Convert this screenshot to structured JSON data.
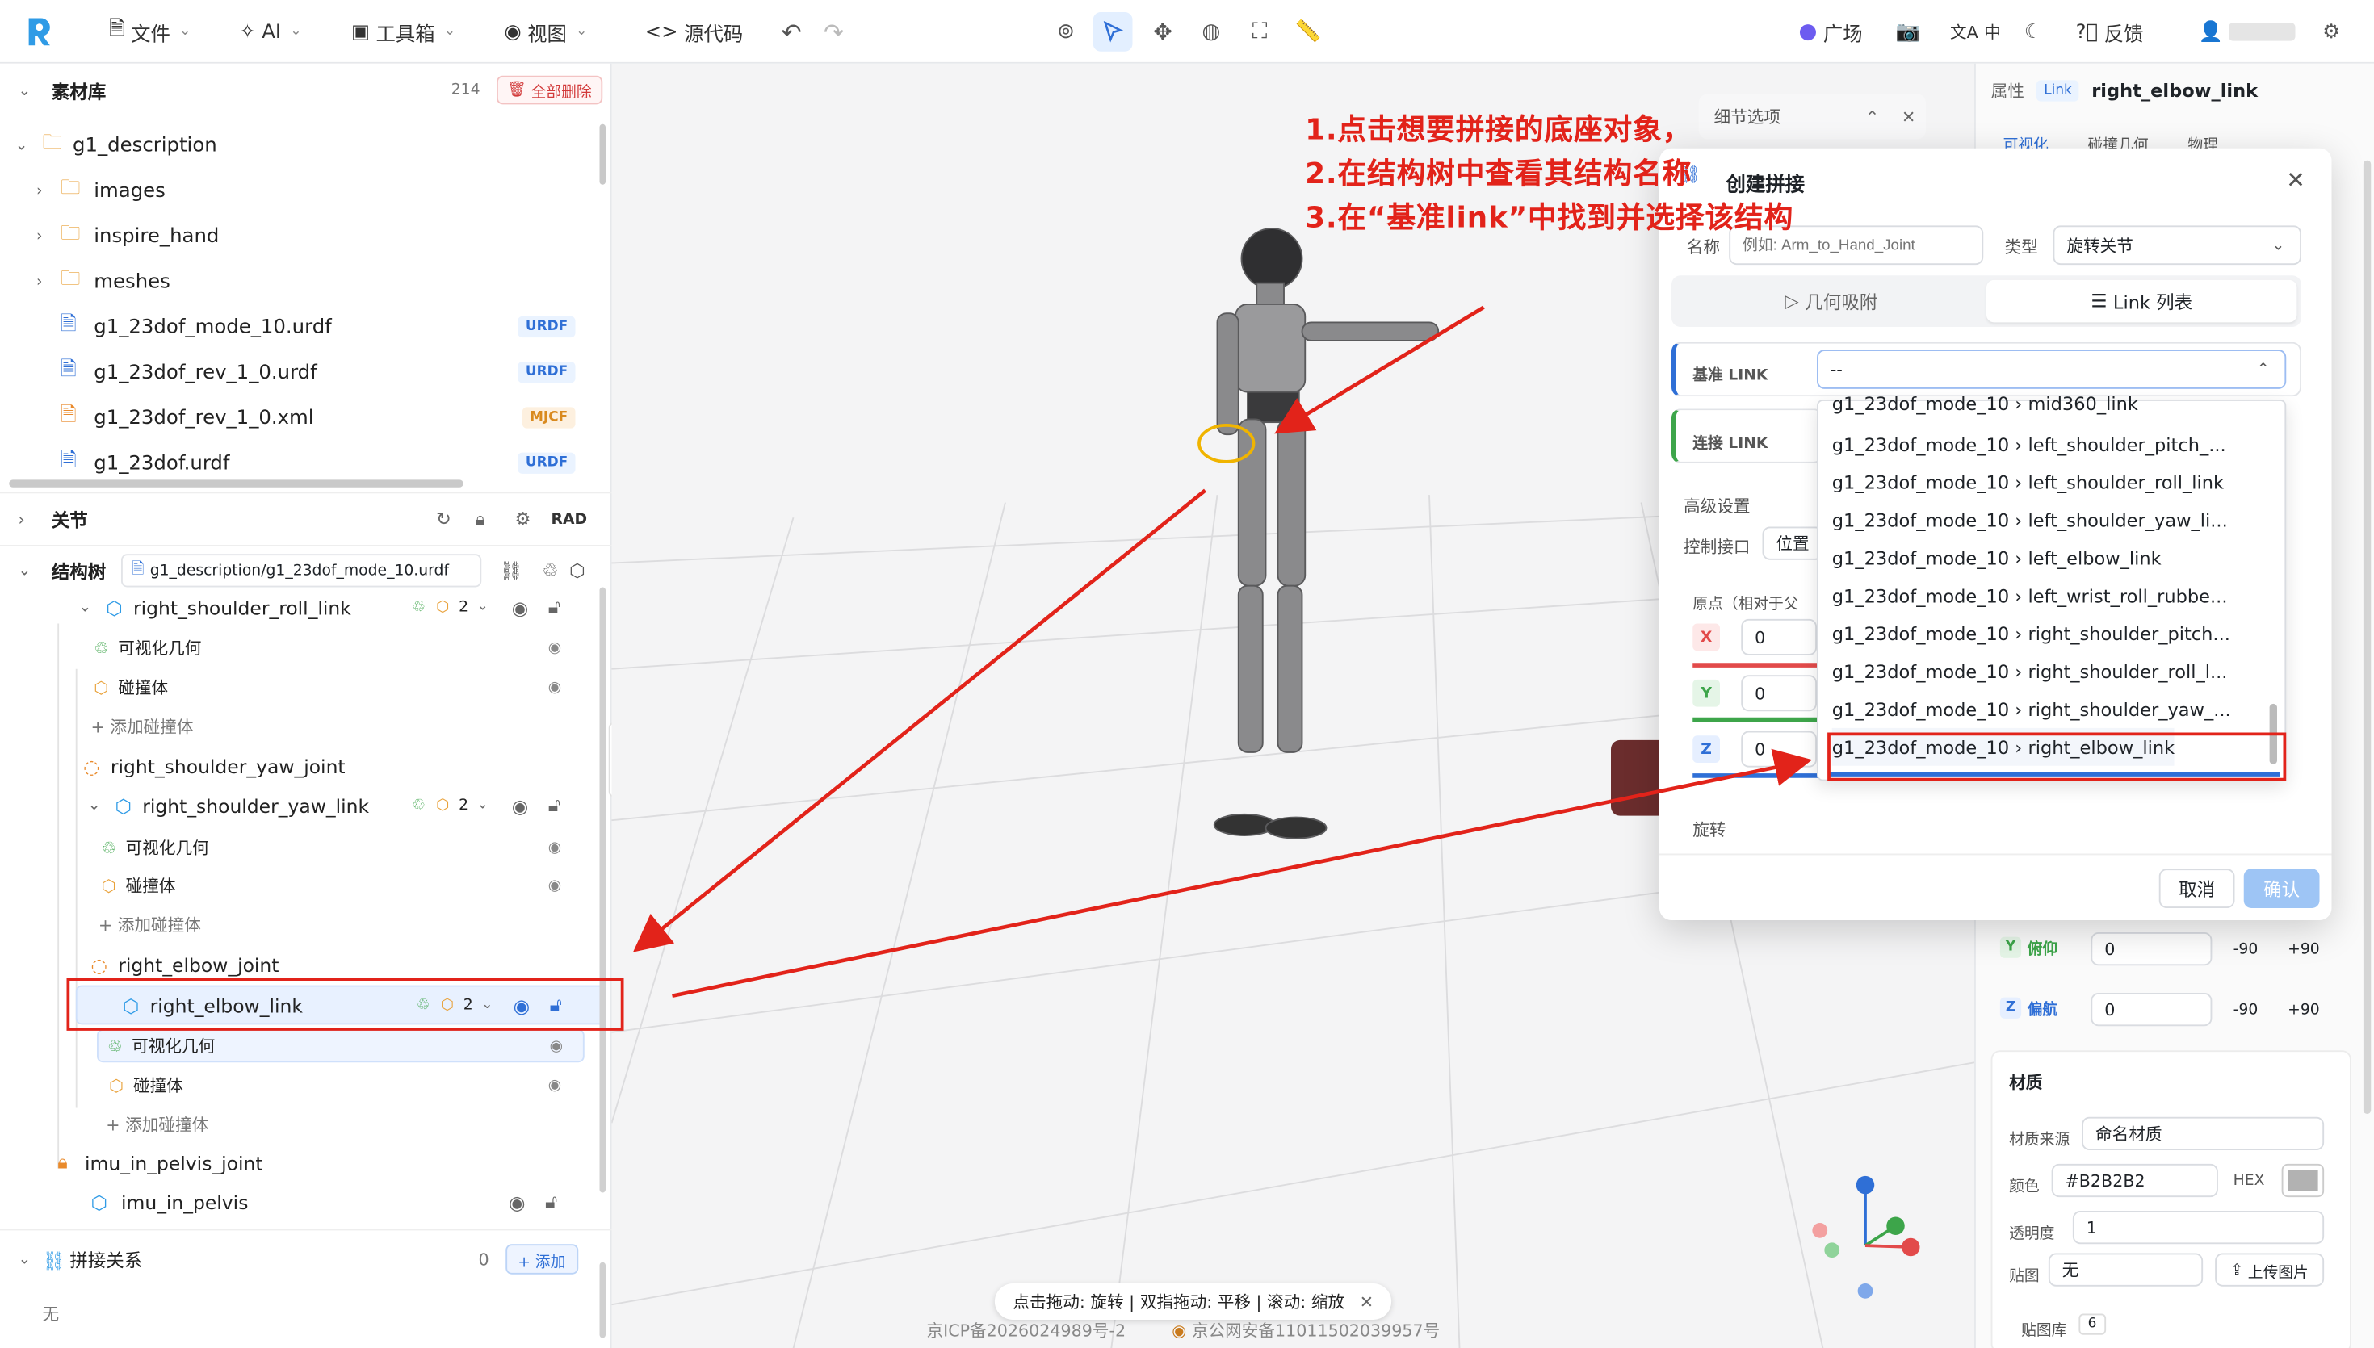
{
  "topbar": {
    "menus": [
      "文件",
      "AI",
      "工具箱",
      "视图",
      "源代码"
    ],
    "right_items": {
      "plaza": "广场",
      "lang": "中",
      "feedback": "反馈"
    }
  },
  "assets": {
    "title": "素材库",
    "count": "214",
    "delete_all": "全部删除",
    "root": "g1_description",
    "folders": [
      "images",
      "inspire_hand",
      "meshes"
    ],
    "files": [
      {
        "name": "g1_23dof_mode_10.urdf",
        "tag": "URDF"
      },
      {
        "name": "g1_23dof_rev_1_0.urdf",
        "tag": "URDF"
      },
      {
        "name": "g1_23dof_rev_1_0.xml",
        "tag": "MJCF"
      },
      {
        "name": "g1_23dof.urdf",
        "tag": "URDF"
      }
    ]
  },
  "joints_section": {
    "title": "关节",
    "unit": "RAD"
  },
  "structure": {
    "title": "结构树",
    "file": "g1_description/g1_23dof_mode_10.urdf",
    "rows": {
      "r1": "right_shoulder_roll_link",
      "vis": "可视化几何",
      "col": "碰撞体",
      "add_col": "+ 添加碰撞体",
      "r2": "right_shoulder_yaw_joint",
      "r3": "right_shoulder_yaw_link",
      "r4": "right_elbow_joint",
      "r5": "right_elbow_link",
      "r6": "imu_in_pelvis_joint",
      "r7": "imu_in_pelvis"
    },
    "count": "2"
  },
  "splice": {
    "title": "拼接关系",
    "count": "0",
    "add": "+ 添加",
    "empty": "无"
  },
  "viewport": {
    "hint": "点击拖动: 旋转 | 双指拖动: 平移 | 滚动: 缩放",
    "icp1": "京ICP备2026024989号-2",
    "icp2": "京公网安备11011502039957号",
    "details_title": "细节选项"
  },
  "annotations": [
    "1.点击想要拼接的底座对象，",
    "2.在结构树中查看其结构名称",
    "3.在“基准link”中找到并选择该结构"
  ],
  "dialog": {
    "title": "创建拼接",
    "name_label": "名称",
    "name_placeholder": "例如: Arm_to_Hand_Joint",
    "type_label": "类型",
    "type_value": "旋转关节",
    "tab_geo": "几何吸附",
    "tab_list": "Link 列表",
    "base_link": "基准 LINK",
    "base_value": "--",
    "conn_link": "连接 LINK",
    "advanced": "高级设置",
    "control": "控制接口",
    "control_value": "位置",
    "origin": "原点（相对于父",
    "axes": [
      "X",
      "Y",
      "Z"
    ],
    "zero": "0",
    "rotation": "旋转",
    "cancel": "取消",
    "confirm": "确认",
    "options": [
      "g1_23dof_mode_10 › mid360_link",
      "g1_23dof_mode_10 › left_shoulder_pitch_...",
      "g1_23dof_mode_10 › left_shoulder_roll_link",
      "g1_23dof_mode_10 › left_shoulder_yaw_li...",
      "g1_23dof_mode_10 › left_elbow_link",
      "g1_23dof_mode_10 › left_wrist_roll_rubbe...",
      "g1_23dof_mode_10 › right_shoulder_pitch...",
      "g1_23dof_mode_10 › right_shoulder_roll_l...",
      "g1_23dof_mode_10 › right_shoulder_yaw_...",
      "g1_23dof_mode_10 › right_elbow_link"
    ]
  },
  "props": {
    "title": "属性",
    "tag": "Link",
    "name": "right_elbow_link",
    "tabs": [
      "可视化",
      "碰撞几何",
      "物理"
    ],
    "pitch": {
      "axis": "Y",
      "label": "俯仰",
      "value": "0",
      "min": "-90",
      "max": "+90"
    },
    "yaw": {
      "axis": "Z",
      "label": "偏航",
      "value": "0",
      "min": "-90",
      "max": "+90"
    },
    "material": "材质",
    "mat_source_label": "材质来源",
    "mat_source": "命名材质",
    "color_label": "颜色",
    "color_value": "#B2B2B2",
    "hex": "HEX",
    "opacity_label": "透明度",
    "opacity": "1",
    "texture_label": "贴图",
    "texture": "无",
    "upload": "上传图片",
    "texlib": "贴图库",
    "texlib_count": "6"
  },
  "colors": {
    "accent": "#2f6fd6",
    "annot": "#e2231a",
    "x": "#e24a4a",
    "y": "#3da54a",
    "z": "#2f6fd6"
  }
}
